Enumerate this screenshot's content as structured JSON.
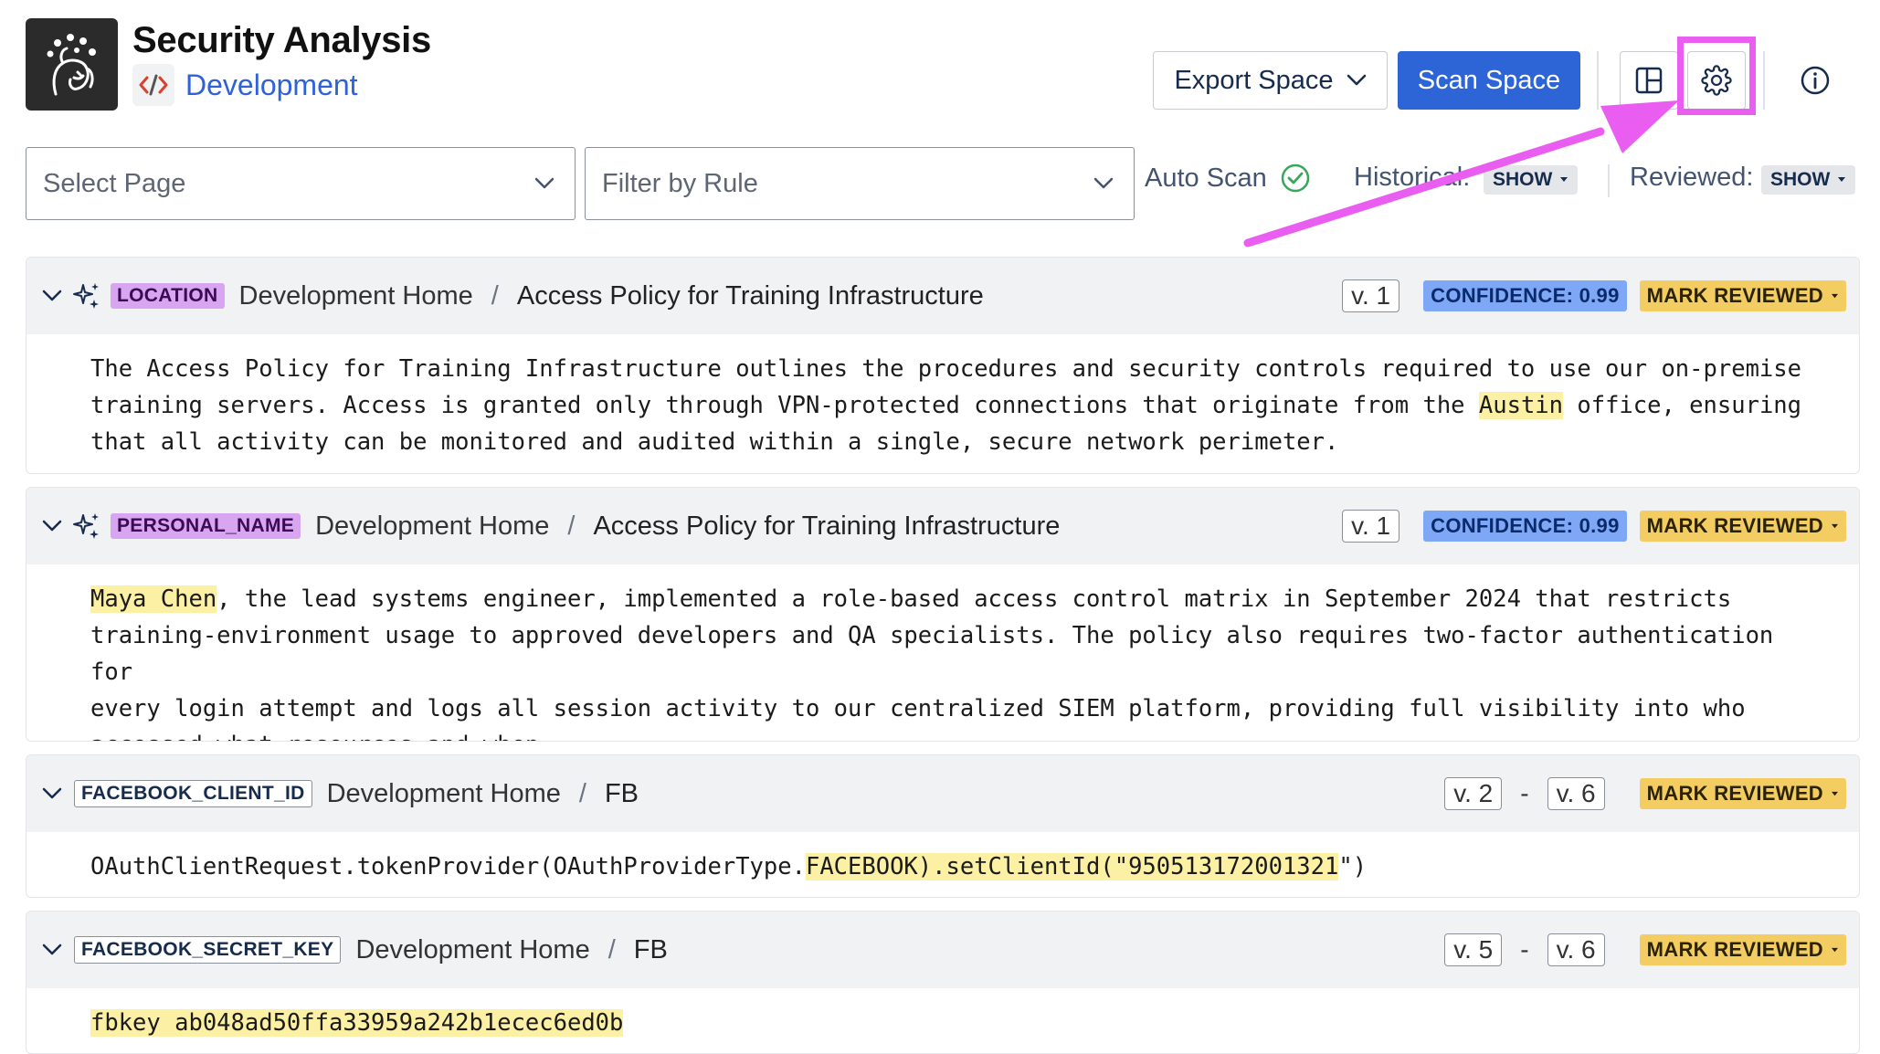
{
  "header": {
    "title": "Security Analysis",
    "space_name": "Development",
    "export_label": "Export Space",
    "scan_label": "Scan Space"
  },
  "filters": {
    "page_placeholder": "Select Page",
    "rule_placeholder": "Filter by Rule",
    "auto_scan_label": "Auto Scan",
    "historical_label": "Historical:",
    "historical_value": "SHOW",
    "reviewed_label": "Reviewed:",
    "reviewed_value": "SHOW"
  },
  "colors": {
    "primary": "#2d64d6",
    "annotation": "#e95ef0",
    "confidence_badge": "#7ea8f5",
    "mark_reviewed_badge": "#f3cd62",
    "highlight": "#fbf0a3",
    "ai_tag": "#d8a5f0"
  },
  "findings": [
    {
      "rule": "LOCATION",
      "space": "Development Home",
      "separator": "/",
      "page": "Access Policy for Training Infrastructure",
      "version": "v. 1",
      "confidence": "CONFIDENCE: 0.99",
      "action": "MARK REVIEWED",
      "text_before": "The Access Policy for Training Infrastructure outlines the procedures and security controls required to use our on-premise\ntraining servers. Access is granted only through VPN-protected connections that originate from the ",
      "text_match": "Austin",
      "text_after": " office, ensuring\nthat all activity can be monitored and audited within a single, secure network perimeter."
    },
    {
      "rule": "PERSONAL_NAME",
      "space": "Development Home",
      "separator": "/",
      "page": "Access Policy for Training Infrastructure",
      "version": "v. 1",
      "confidence": "CONFIDENCE: 0.99",
      "action": "MARK REVIEWED",
      "text_before": "",
      "text_match": "Maya Chen",
      "text_after": ", the lead systems engineer, implemented a role-based access control matrix in September 2024 that restricts\ntraining-environment usage to approved developers and QA specialists. The policy also requires two-factor authentication for\nevery login attempt and logs all session activity to our centralized SIEM platform, providing full visibility into who\naccessed what resources and when."
    },
    {
      "rule": "FACEBOOK_CLIENT_ID",
      "space": "Development Home",
      "separator": "/",
      "page": "FB",
      "version_from": "v. 2",
      "version_to": "v. 6",
      "range_sep": "-",
      "action": "MARK REVIEWED",
      "text_before": "OAuthClientRequest.tokenProvider(OAuthProviderType.",
      "text_match": "FACEBOOK).setClientId(\"950513172001321",
      "text_after": "\")"
    },
    {
      "rule": "FACEBOOK_SECRET_KEY",
      "space": "Development Home",
      "separator": "/",
      "page": "FB",
      "version_from": "v. 5",
      "version_to": "v. 6",
      "range_sep": "-",
      "action": "MARK REVIEWED",
      "text_before": "",
      "text_match": "fbkey ab048ad50ffa33959a242b1ecec6ed0b",
      "text_after": ""
    }
  ]
}
